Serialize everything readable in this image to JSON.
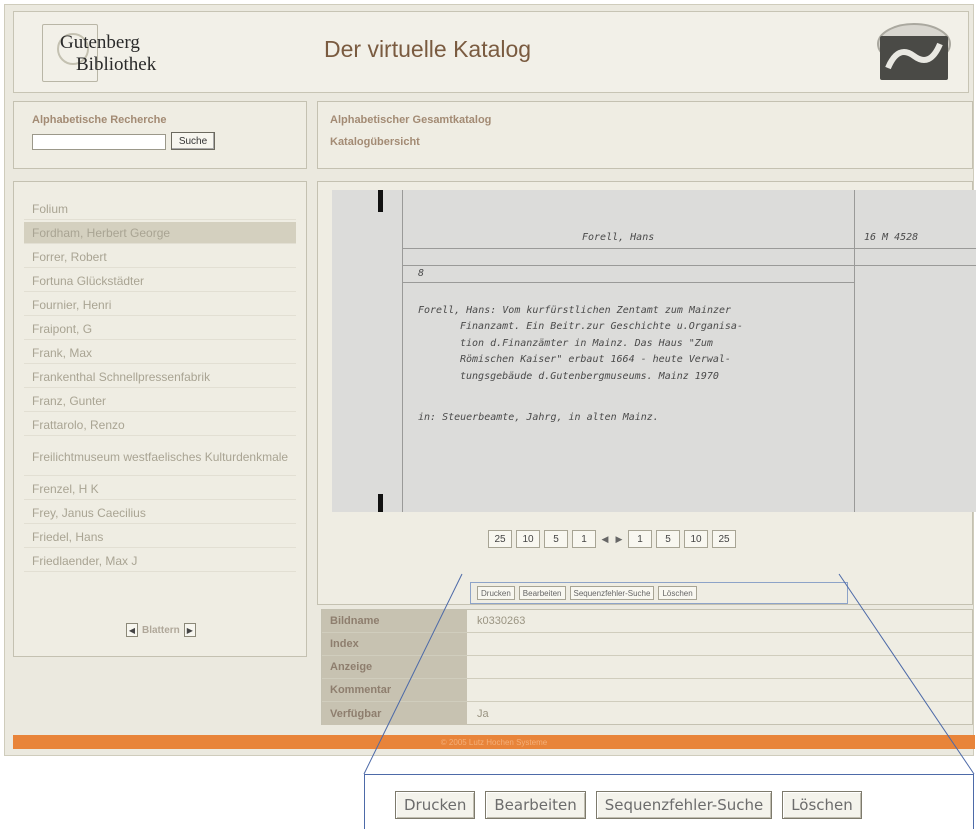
{
  "header": {
    "logo_line1": "Gutenberg",
    "logo_line2": "Bibliothek",
    "title": "Der virtuelle Katalog"
  },
  "search": {
    "label": "Alphabetische Recherche",
    "value": "",
    "button": "Suche"
  },
  "breadcrumb": {
    "line1": "Alphabetischer Gesamtkatalog",
    "line2": "Katalogübersicht"
  },
  "list": {
    "items": [
      {
        "label": "Folium",
        "selected": false
      },
      {
        "label": "Fordham, Herbert George",
        "selected": true
      },
      {
        "label": "Forrer, Robert",
        "selected": false
      },
      {
        "label": "Fortuna Glückstädter",
        "selected": false
      },
      {
        "label": "Fournier, Henri",
        "selected": false
      },
      {
        "label": "Fraipont, G",
        "selected": false
      },
      {
        "label": "Frank, Max",
        "selected": false
      },
      {
        "label": "Frankenthal Schnellpressenfabrik",
        "selected": false
      },
      {
        "label": "Franz, Gunter",
        "selected": false
      },
      {
        "label": "Frattarolo, Renzo",
        "selected": false
      },
      {
        "label": "Freilichtmuseum westfaelisches Kulturdenkmale",
        "selected": false
      },
      {
        "label": "Frenzel, H K",
        "selected": false
      },
      {
        "label": "Frey, Janus Caecilius",
        "selected": false
      },
      {
        "label": "Friedel, Hans",
        "selected": false
      },
      {
        "label": "Friedlaender, Max J",
        "selected": false
      }
    ],
    "blattern_label": "Blattern"
  },
  "card": {
    "heading": "Forell, Hans",
    "signature": "16 M 4528",
    "marker": "8",
    "body_lines": [
      "Forell, Hans: Vom kurfürstlichen Zentamt zum Mainzer",
      "Finanzamt. Ein Beitr.zur Geschichte u.Organisa-",
      "tion d.Finanzämter in Mainz. Das Haus \"Zum",
      "Römischen Kaiser\" erbaut 1664 - heute Verwal-",
      "tungsgebäude d.Gutenbergmuseums. Mainz 1970"
    ],
    "footer_line": "in: Steuerbeamte, Jahrg, in alten Mainz."
  },
  "pager": {
    "back": [
      "25",
      "10",
      "5",
      "1"
    ],
    "forward": [
      "1",
      "5",
      "10",
      "25"
    ]
  },
  "actions": {
    "print": "Drucken",
    "edit": "Bearbeiten",
    "sequence": "Sequenzfehler-Suche",
    "delete": "Löschen"
  },
  "info": {
    "bildname_label": "Bildname",
    "bildname_value": "k0330263",
    "index_label": "Index",
    "index_value": "",
    "anzeige_label": "Anzeige",
    "anzeige_value": "",
    "kommentar_label": "Kommentar",
    "kommentar_value": "",
    "verfuegbar_label": "Verfügbar",
    "verfuegbar_value": "Ja"
  },
  "footer": {
    "text": "© 2005 Lutz Hochen Systeme"
  },
  "colors": {
    "accent_orange": "#e8843a",
    "label_brown": "#a38b74",
    "zoom_outline": "#4d6aa8"
  }
}
